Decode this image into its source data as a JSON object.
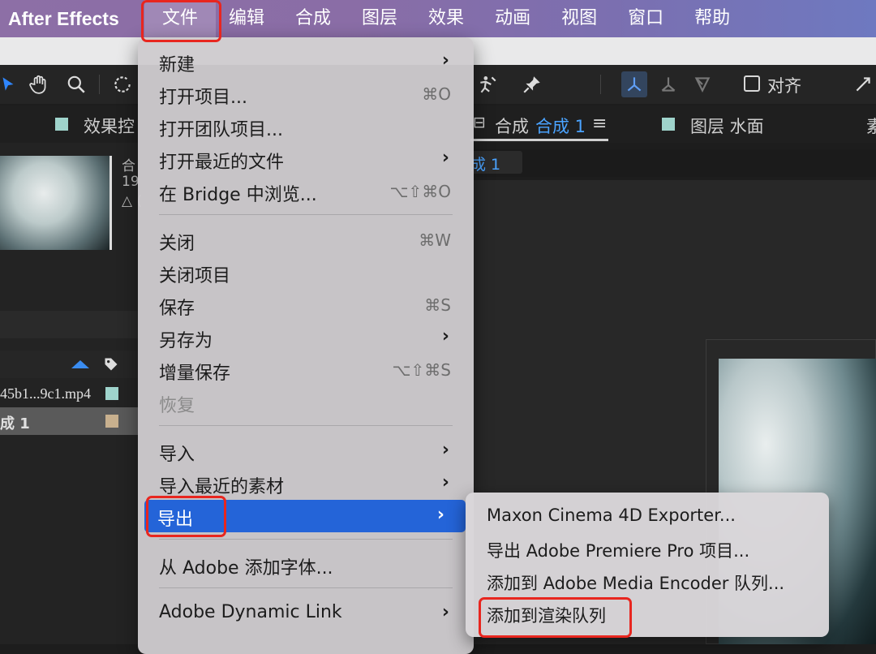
{
  "menubar": {
    "app_name": "After Effects",
    "items": [
      "文件",
      "编辑",
      "合成",
      "图层",
      "效果",
      "动画",
      "视图",
      "窗口",
      "帮助"
    ]
  },
  "toolbar": {
    "tools": [
      "selection-tool",
      "hand-tool",
      "zoom-tool",
      "rotate-tool",
      "puppet-tool",
      "pin-tool"
    ],
    "snap_label": "对齐"
  },
  "left_panel": {
    "tab_label": "效果控",
    "meta_lines": [
      "合",
      "19",
      "△ ("
    ],
    "rows": [
      {
        "name": "45b1...9c1.mp4",
        "swatch": "#9fd4cc"
      },
      {
        "name": "成 1",
        "swatch": "#c8b08e"
      }
    ]
  },
  "right_panel": {
    "comp_tab_prefix": "合成",
    "comp_tab_name": "合成 1",
    "layer_tab_label": "图层 水面",
    "comp_breadcrumb": "成 1",
    "more_tab": "素"
  },
  "file_menu": {
    "items": [
      {
        "label": "新建",
        "shortcut": "",
        "submenu": true
      },
      {
        "label": "打开项目...",
        "shortcut": "⌘O",
        "submenu": false
      },
      {
        "label": "打开团队项目...",
        "shortcut": "",
        "submenu": false
      },
      {
        "label": "打开最近的文件",
        "shortcut": "",
        "submenu": true
      },
      {
        "label": "在 Bridge 中浏览...",
        "shortcut": "⌥⇧⌘O",
        "submenu": false
      },
      {
        "label": "关闭",
        "shortcut": "⌘W",
        "submenu": false
      },
      {
        "label": "关闭项目",
        "shortcut": "",
        "submenu": false
      },
      {
        "label": "保存",
        "shortcut": "⌘S",
        "submenu": false
      },
      {
        "label": "另存为",
        "shortcut": "",
        "submenu": true
      },
      {
        "label": "增量保存",
        "shortcut": "⌥⇧⌘S",
        "submenu": false
      },
      {
        "label": "恢复",
        "shortcut": "",
        "submenu": false,
        "disabled": true
      },
      {
        "label": "导入",
        "shortcut": "",
        "submenu": true
      },
      {
        "label": "导入最近的素材",
        "shortcut": "",
        "submenu": true
      },
      {
        "label": "导出",
        "shortcut": "",
        "submenu": true,
        "highlighted": true
      },
      {
        "label": "从 Adobe 添加字体...",
        "shortcut": "",
        "submenu": false
      },
      {
        "label": "Adobe Dynamic Link",
        "shortcut": "",
        "submenu": true
      }
    ]
  },
  "export_submenu": {
    "items": [
      "Maxon Cinema 4D Exporter...",
      "导出 Adobe Premiere Pro 项目...",
      "添加到 Adobe Media Encoder 队列...",
      "添加到渲染队列"
    ]
  },
  "colors": {
    "highlight": "#2464d8",
    "annotation": "#e8261f",
    "comp_accent": "#4aa3ff"
  }
}
